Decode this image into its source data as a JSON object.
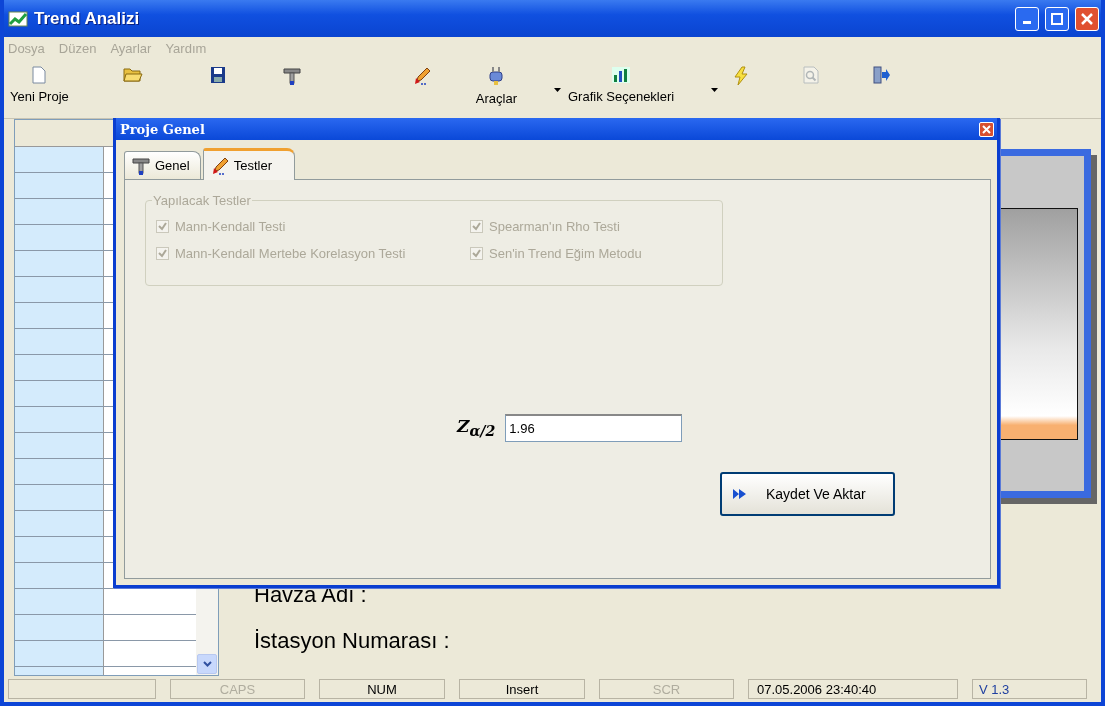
{
  "window": {
    "title": "Trend Analizi"
  },
  "menu": [
    "Dosya",
    "Düzen",
    "Ayarlar",
    "Yardım"
  ],
  "toolbar": [
    {
      "kind": "new",
      "label": "Yeni Proje",
      "disabled": false
    },
    {
      "kind": "open",
      "disabled": false
    },
    {
      "kind": "save",
      "disabled": false
    },
    {
      "kind": "hammer",
      "disabled": false
    },
    {
      "kind": "pencil",
      "disabled": false
    },
    {
      "kind": "plug",
      "label": "Araçlar",
      "disabled": false
    },
    {
      "kind": "arrow",
      "disabled": false
    },
    {
      "kind": "chart",
      "label": "Grafik Seçenekleri",
      "disabled": false
    },
    {
      "kind": "arrow",
      "disabled": false
    },
    {
      "kind": "bolt",
      "disabled": false
    },
    {
      "kind": "preview",
      "disabled": true
    },
    {
      "kind": "exit",
      "disabled": false
    }
  ],
  "fields": [
    {
      "label": "Havza Adı :"
    },
    {
      "label": "İstasyon Numarası :"
    }
  ],
  "dialog": {
    "title": "Proje Genel",
    "tabs": [
      {
        "kind": "hammer",
        "label": "Genel",
        "selected": false
      },
      {
        "kind": "pencil",
        "label": "Testler",
        "selected": true
      }
    ],
    "group": {
      "title": "Yapılacak Testler",
      "options": [
        {
          "label": "Mann-Kendall Testi",
          "checked": true,
          "disabled": true
        },
        {
          "label": "Spearman'ın Rho Testi",
          "checked": true,
          "disabled": true
        },
        {
          "label": "Mann-Kendall Mertebe Korelasyon Testi",
          "checked": true,
          "disabled": true
        },
        {
          "label": "Sen'in Trend Eğim Metodu",
          "checked": true,
          "disabled": true
        }
      ]
    },
    "z_label": "Z$_{α/2}$",
    "z_value": "1.96",
    "button": "Kaydet Ve Aktar"
  },
  "status_bar": [
    {
      "text": "CAPS",
      "disabled": true
    },
    {
      "text": "NUM",
      "disabled": false
    },
    {
      "text": "Insert",
      "disabled": false
    },
    {
      "text": "SCR",
      "disabled": true
    },
    {
      "text": "07.05.2006 23:40:40",
      "disabled": false
    },
    {
      "text": "V 1.3",
      "disabled": false
    }
  ]
}
